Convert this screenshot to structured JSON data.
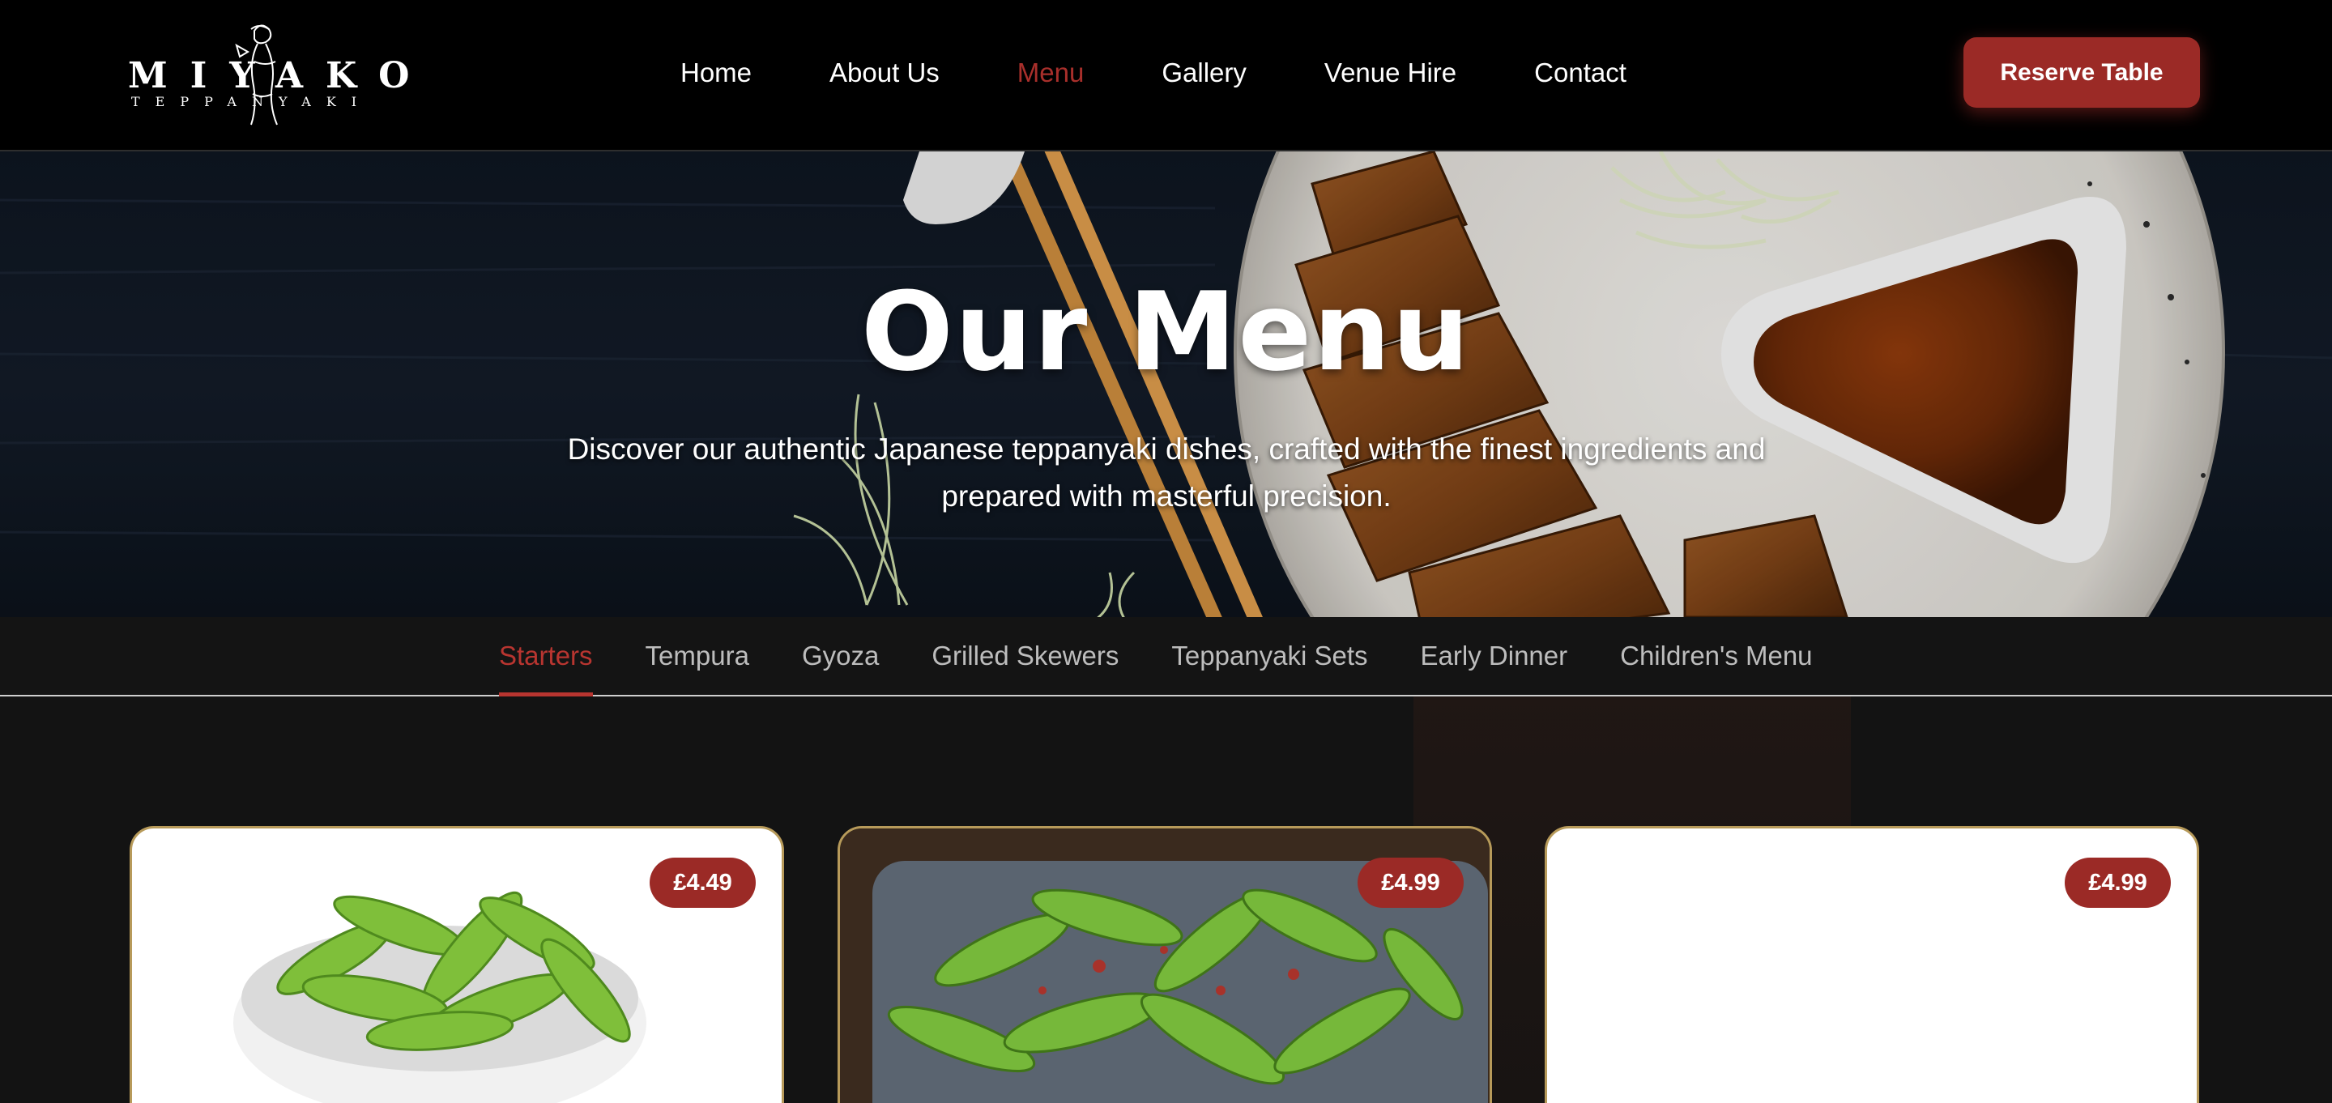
{
  "header": {
    "logo": {
      "word": "MIYAKO",
      "sub": "TEPPANYAKI"
    },
    "nav": [
      {
        "label": "Home",
        "active": false
      },
      {
        "label": "About Us",
        "active": false
      },
      {
        "label": "Menu",
        "active": true
      },
      {
        "label": "Gallery",
        "active": false
      },
      {
        "label": "Venue Hire",
        "active": false
      },
      {
        "label": "Contact",
        "active": false
      }
    ],
    "cta_label": "Reserve Table"
  },
  "hero": {
    "title": "Our Menu",
    "subtitle": "Discover our authentic Japanese teppanyaki dishes, crafted with the finest ingredients and prepared with masterful precision."
  },
  "categories": [
    {
      "label": "Starters",
      "active": true
    },
    {
      "label": "Tempura",
      "active": false
    },
    {
      "label": "Gyoza",
      "active": false
    },
    {
      "label": "Grilled Skewers",
      "active": false
    },
    {
      "label": "Teppanyaki Sets",
      "active": false
    },
    {
      "label": "Early Dinner",
      "active": false
    },
    {
      "label": "Children's Menu",
      "active": false
    }
  ],
  "menu_items": [
    {
      "price": "£4.49",
      "image": "edamame-bowl"
    },
    {
      "price": "£4.99",
      "image": "spicy-edamame"
    },
    {
      "price": "£4.99",
      "image": ""
    }
  ],
  "colors": {
    "accent": "#9b2a26",
    "active_nav": "#a82f2b",
    "card_border": "#b79a5a"
  }
}
